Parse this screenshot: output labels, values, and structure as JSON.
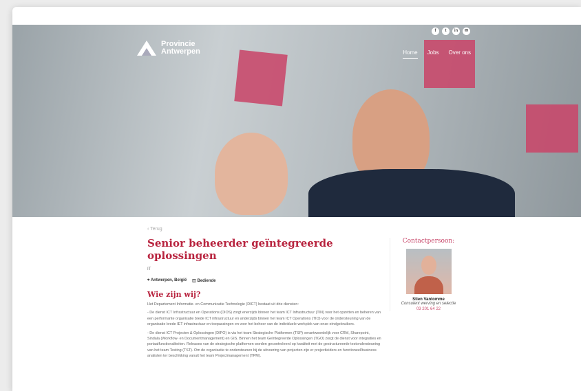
{
  "browser": {
    "colors": {
      "close": "#f25a5a",
      "minimize": "#f5b92f",
      "maximize": "#4fc34c"
    }
  },
  "header": {
    "logo_line1": "Provincie",
    "logo_line2": "Antwerpen",
    "nav": [
      "Home",
      "Jobs",
      "Over ons"
    ],
    "social_icons": [
      "facebook-icon",
      "twitter-icon",
      "linkedin-icon",
      "email-icon"
    ]
  },
  "job": {
    "back_label": "Terug",
    "title": "Senior beheerder geïntegreerde oplossingen",
    "category": "IT",
    "location": "Antwerpen, België",
    "type": "Bediende",
    "section_title": "Wie zijn wij?",
    "paragraphs": [
      "Het Departement Informatie- en Communicatie Technologie (DICT) bestaat uit drie diensten:",
      "- De dienst ICT Infrastructuur en Operations (DIOS) zorgt enerzijds binnen het team ICT Infrastructuur (TIN) voor het opzetten en beheren van een performante organisatie brede ICT infrastructuur en anderzijds binnen het team ICT Operations (TIO) voor de ondersteuning van de organisatie brede IET infrastructuur en toepassingen en voor het beheer van de individuele werkplek van onze eindgebruikers.",
      "- De dienst ICT Projecten & Oplossingen (DIPO) is via het team Strategische Platformen (TSP) verantwoordelijk voor CRM, Sharepoint, Sindala (Workflow- en Documentmanagement) en GIS. Binnen het team Geïntegreerde Oplossingen (TGO) zorgt de dienst voor integraties en portaalfunctionaliteiten. Releases van de strategische platformen worden gecontroleerd op kwaliteit met de gestructureerde testondersteuning van het team Testing (TST). Om de organisatie te ondersteunen bij de uitvoering van projecten zijn er projectleiders en functioneel/business analisten ter beschikking vanuit het team Projectmanagement (TPM)."
    ]
  },
  "contact": {
    "title": "Contactpersoon:",
    "name": "Stien Vantomme",
    "role": "Consulent werving en selectie",
    "phone": "03 201 64 22"
  }
}
